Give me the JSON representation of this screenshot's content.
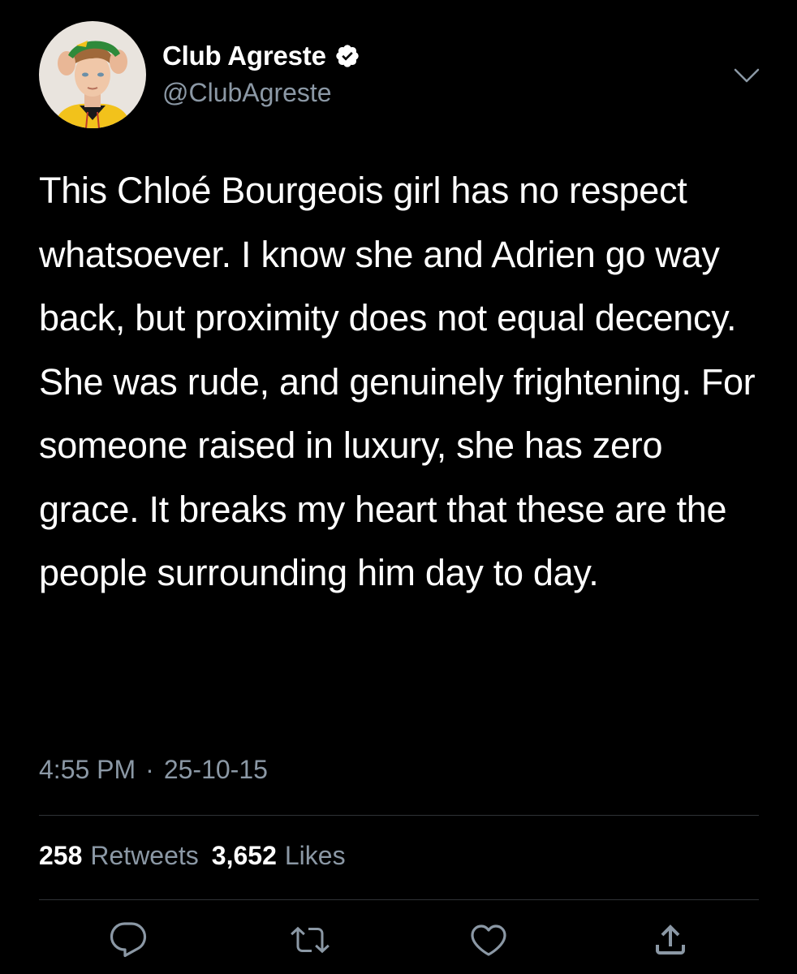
{
  "tweet": {
    "author": {
      "display_name": "Club Agreste",
      "handle": "@ClubAgreste",
      "verified": true
    },
    "text": "This Chloé Bourgeois girl has no respect whatsoever. I know she and Adrien go way back, but proximity does not equal decency. She was rude, and genuinely frightening. For someone raised in luxury, she has zero grace. It breaks my heart that these are the people surrounding him day to day.",
    "time": "4:55 PM",
    "separator": "·",
    "date": "25-10-15",
    "stats": {
      "retweets_count": "258",
      "retweets_label": "Retweets",
      "likes_count": "3,652",
      "likes_label": "Likes"
    },
    "actions": [
      {
        "icon": "reply-icon"
      },
      {
        "icon": "retweet-icon"
      },
      {
        "icon": "like-icon"
      },
      {
        "icon": "share-icon"
      }
    ]
  },
  "colors": {
    "background": "#000000",
    "text": "#ffffff",
    "secondary_text": "#8b98a5",
    "divider": "#2f3336",
    "verified": "#ffffff"
  }
}
